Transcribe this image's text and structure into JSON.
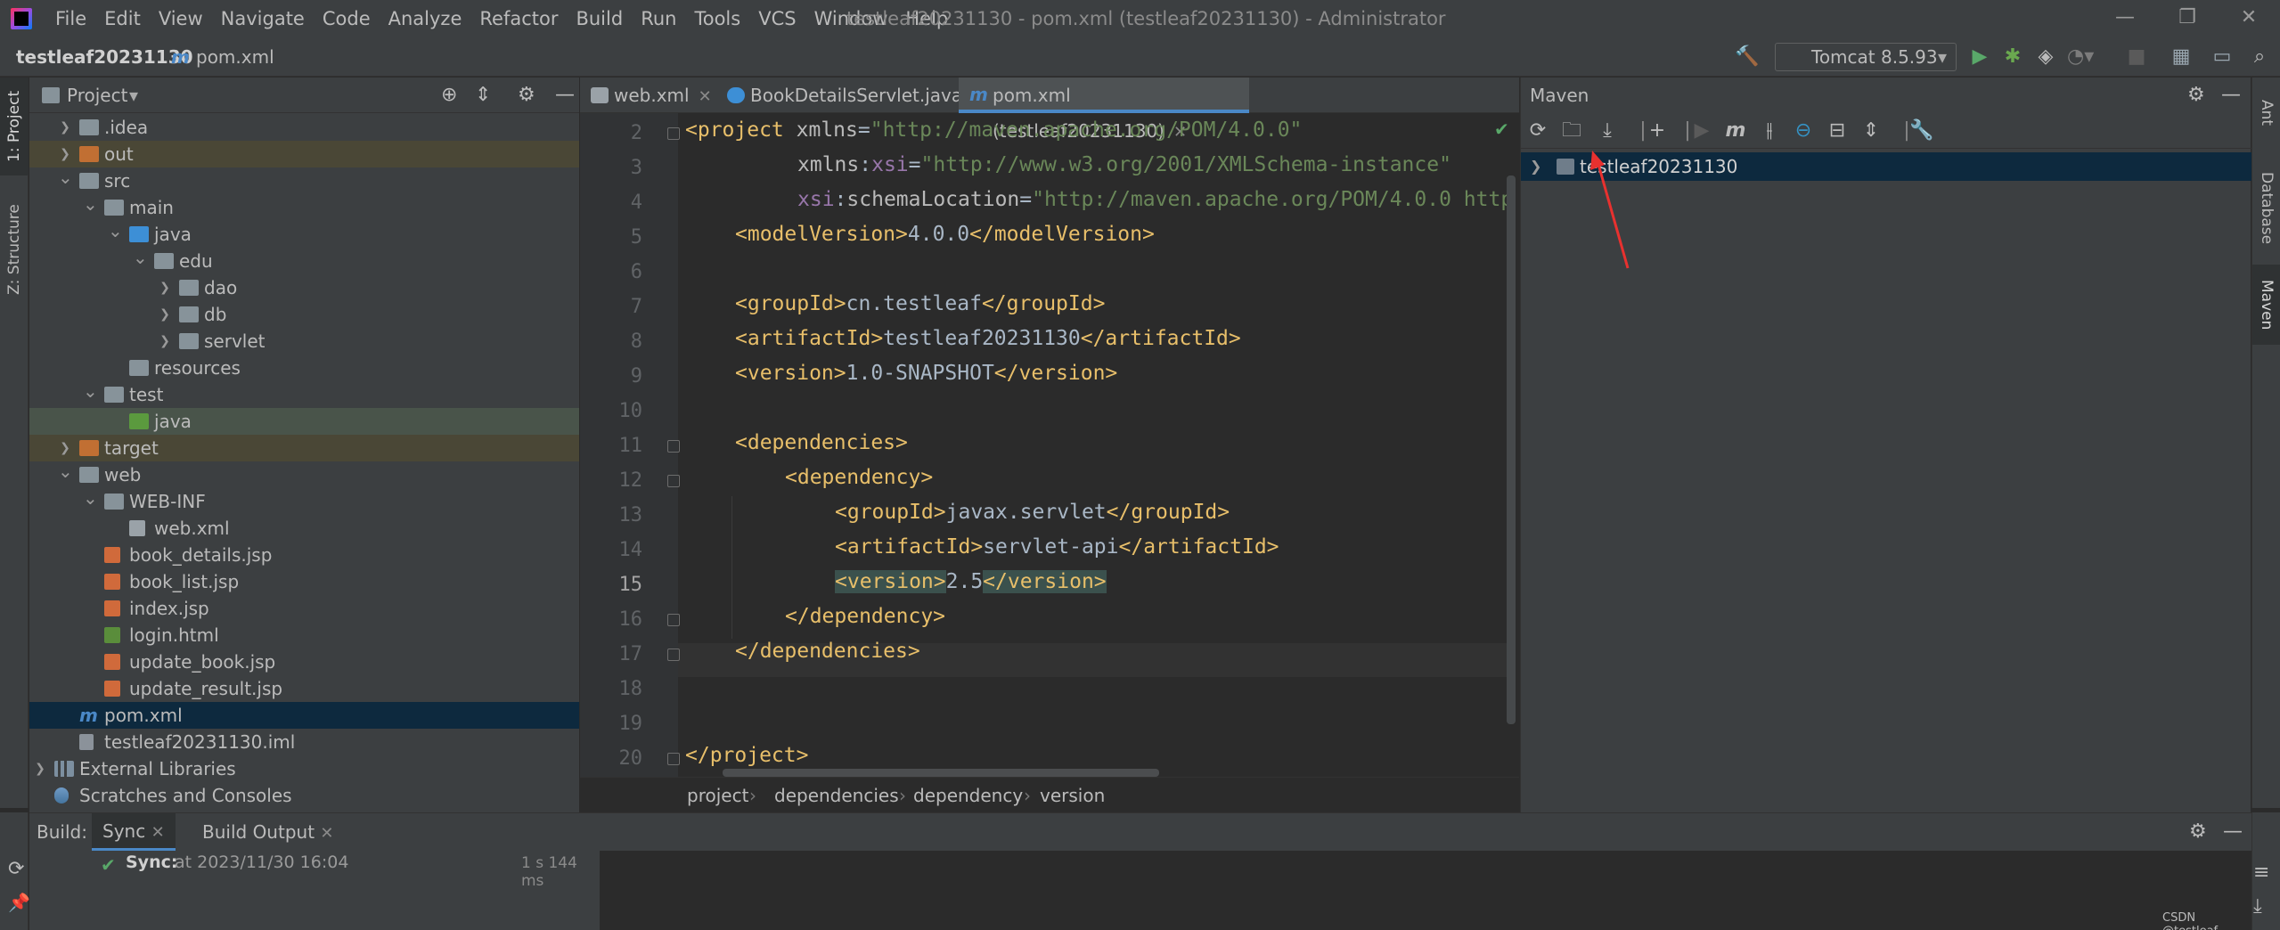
{
  "window": {
    "title": "testleaf20231130 - pom.xml (testleaf20231130) - Administrator",
    "menu": [
      "File",
      "Edit",
      "View",
      "Navigate",
      "Code",
      "Analyze",
      "Refactor",
      "Build",
      "Run",
      "Tools",
      "VCS",
      "Window",
      "Help"
    ]
  },
  "navbar": {
    "project": "testleaf20231130",
    "file": "pom.xml",
    "run_config": "Tomcat 8.5.93"
  },
  "left_stripe": {
    "project_tab": "1: Project",
    "structure_tab": "Z: Structure"
  },
  "right_stripe": {
    "ant_tab": "Ant",
    "database_tab": "Database",
    "maven_tab": "Maven"
  },
  "project_panel": {
    "title": "Project",
    "tree": [
      {
        "label": ".idea",
        "kind": "folder"
      },
      {
        "label": "out",
        "kind": "folder-orange"
      },
      {
        "label": "src",
        "kind": "folder"
      },
      {
        "label": "main",
        "kind": "folder"
      },
      {
        "label": "java",
        "kind": "folder-blue"
      },
      {
        "label": "edu",
        "kind": "folder"
      },
      {
        "label": "dao",
        "kind": "folder"
      },
      {
        "label": "db",
        "kind": "folder"
      },
      {
        "label": "servlet",
        "kind": "folder"
      },
      {
        "label": "resources",
        "kind": "folder"
      },
      {
        "label": "test",
        "kind": "folder"
      },
      {
        "label": "java",
        "kind": "folder-green"
      },
      {
        "label": "target",
        "kind": "folder-orange"
      },
      {
        "label": "web",
        "kind": "folder"
      },
      {
        "label": "WEB-INF",
        "kind": "folder"
      },
      {
        "label": "web.xml",
        "kind": "file-xml"
      },
      {
        "label": "book_details.jsp",
        "kind": "file-jsp"
      },
      {
        "label": "book_list.jsp",
        "kind": "file-jsp"
      },
      {
        "label": "index.jsp",
        "kind": "file-jsp"
      },
      {
        "label": "login.html",
        "kind": "file-html"
      },
      {
        "label": "update_book.jsp",
        "kind": "file-jsp"
      },
      {
        "label": "update_result.jsp",
        "kind": "file-jsp"
      },
      {
        "label": "pom.xml",
        "kind": "maven"
      },
      {
        "label": "testleaf20231130.iml",
        "kind": "file-iml"
      },
      {
        "label": "External Libraries",
        "kind": "lib"
      },
      {
        "label": "Scratches and Consoles",
        "kind": "scratch"
      }
    ]
  },
  "editor": {
    "tabs": [
      {
        "label": "web.xml"
      },
      {
        "label": "BookDetailsServlet.java"
      },
      {
        "label": "pom.xml (testleaf20231130)"
      }
    ],
    "line_numbers": [
      "2",
      "3",
      "4",
      "5",
      "6",
      "7",
      "8",
      "9",
      "10",
      "11",
      "12",
      "13",
      "14",
      "15",
      "16",
      "17",
      "18",
      "19",
      "20"
    ],
    "lines": {
      "l2_open": "<project ",
      "l2_attr": "xmlns",
      "l2_eq": "=",
      "l2_val": "\"http://maven.apache.org/POM/4.0.0\"",
      "l3_ns": "xmlns",
      "l3_colon": ":",
      "l3_attr": "xsi",
      "l3_eq": "=",
      "l3_val": "\"http://www.w3.org/2001/XMLSchema-instance\"",
      "l4_ns": "xsi",
      "l4_colon": ":",
      "l4_attr": "schemaLocation",
      "l4_eq": "=",
      "l4_val": "\"http://maven.apache.org/POM/4.0.0 http",
      "l5_open": "<modelVersion>",
      "l5_text": "4.0.0",
      "l5_close": "</modelVersion>",
      "l7_open": "<groupId>",
      "l7_text": "cn.testleaf",
      "l7_close": "</groupId>",
      "l8_open": "<artifactId>",
      "l8_text": "testleaf20231130",
      "l8_close": "</artifactId>",
      "l9_open": "<version>",
      "l9_text": "1.0-SNAPSHOT",
      "l9_close": "</version>",
      "l11": "<dependencies>",
      "l12": "<dependency>",
      "l13_open": "<groupId>",
      "l13_text": "javax.servlet",
      "l13_close": "</groupId>",
      "l14_open": "<artifactId>",
      "l14_text": "servlet-api",
      "l14_close": "</artifactId>",
      "l15_open": "<version>",
      "l15_text": "2.5",
      "l15_close": "</version>",
      "l16": "</dependency>",
      "l17": "</dependencies>",
      "l20": "</project>"
    },
    "breadcrumbs": [
      "project",
      "dependencies",
      "dependency",
      "version"
    ]
  },
  "maven_panel": {
    "title": "Maven",
    "project": "testleaf20231130"
  },
  "build_panel": {
    "label": "Build:",
    "tabs": [
      "Sync",
      "Build Output"
    ],
    "sync_label": "Sync:",
    "sync_text": "at 2023/11/30 16:04",
    "duration": "1 s 144 ms"
  },
  "watermark": "CSDN @testleaf",
  "colors": {
    "accent": "#4a88c7",
    "selection": "#0d293e",
    "tag": "#e8bf6a",
    "string": "#6a8759",
    "arrow": "#e8312f"
  }
}
